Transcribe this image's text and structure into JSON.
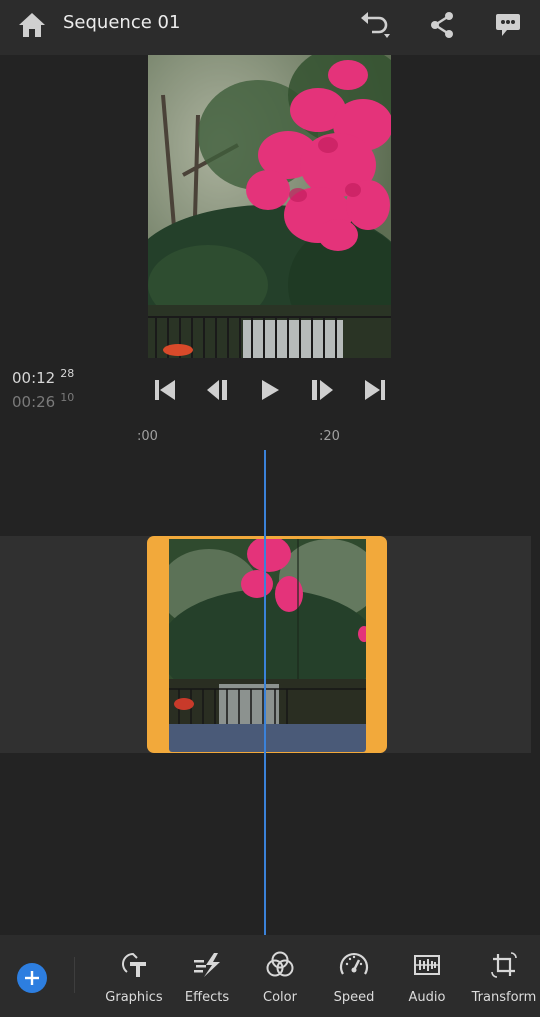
{
  "header": {
    "title": "Sequence 01",
    "icons": [
      "home-icon",
      "undo-icon",
      "share-icon",
      "feedback-icon"
    ]
  },
  "preview": {
    "description": "Pink bougainvillea flowers in front of trees and a garden fence",
    "colors": {
      "flower": "#e4337a",
      "foliage": "#2f4a2c",
      "sky": "#d8d4c4"
    }
  },
  "timecode": {
    "current": "00:12",
    "current_frames": "28",
    "total": "00:26",
    "total_frames": "10"
  },
  "transport": {
    "buttons": [
      "skip-to-start",
      "step-back",
      "play",
      "step-forward",
      "skip-to-end"
    ]
  },
  "ruler": {
    "labels": [
      ":00",
      ":20"
    ]
  },
  "timeline": {
    "clip_color": "#f2a93b",
    "playhead_color": "#3b82d9",
    "audio_color": "#4a5a78"
  },
  "toolbar": {
    "add_label": "+",
    "tools": [
      {
        "id": "graphics",
        "label": "Graphics",
        "icon": "graphics-icon"
      },
      {
        "id": "effects",
        "label": "Effects",
        "icon": "effects-icon"
      },
      {
        "id": "color",
        "label": "Color",
        "icon": "color-icon"
      },
      {
        "id": "speed",
        "label": "Speed",
        "icon": "speed-icon"
      },
      {
        "id": "audio",
        "label": "Audio",
        "icon": "audio-icon"
      },
      {
        "id": "transform",
        "label": "Transform",
        "icon": "transform-icon"
      }
    ]
  }
}
